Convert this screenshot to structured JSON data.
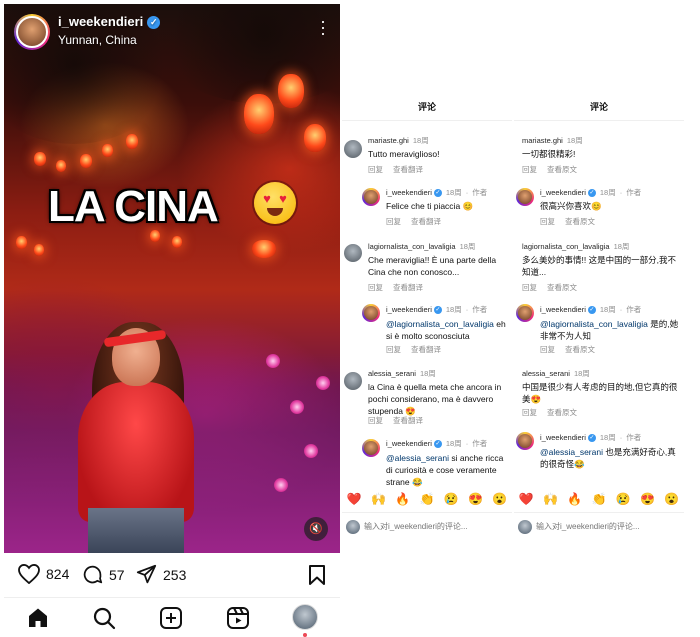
{
  "post": {
    "username": "i_weekendieri",
    "verified": true,
    "location": "Yunnan, China",
    "overlay_text": "LA CINA",
    "overlay_emoji": "heart-eyes-emoji",
    "likes": "824",
    "comments": "57",
    "shares": "253"
  },
  "icons": {
    "heart": "heart-icon",
    "comment": "comment-icon",
    "share": "share-icon",
    "bookmark": "bookmark-icon",
    "home": "home-icon",
    "search": "search-icon",
    "create": "create-icon",
    "reels": "reels-icon",
    "more": "more-icon",
    "mute": "mute-icon"
  },
  "colors": {
    "verified": "#3897f0",
    "mention": "#00376b",
    "meta": "#8e8e8e",
    "notification_dot": "#ed4956"
  },
  "pane_it": {
    "title": "评论",
    "comments": [
      {
        "user": "mariaste.ghi",
        "time": "18周",
        "author": "",
        "text": "Tutto meraviglioso!",
        "reply": "回复",
        "translate": "查看翻译"
      },
      {
        "user": "i_weekendieri",
        "time": "18周",
        "author": "作者",
        "text": "Felice che ti piaccia 😊",
        "reply": "回复",
        "translate": "查看翻译"
      },
      {
        "user": "lagiornalista_con_lavaligia",
        "time": "18周",
        "author": "",
        "text": "Che meraviglia!! È una parte della Cina che non conosco...",
        "reply": "回复",
        "translate": "查看翻译"
      },
      {
        "user": "i_weekendieri",
        "time": "18周",
        "author": "作者",
        "mention": "@lagiornalista_con_lavaligia",
        "text": " eh si è molto sconosciuta",
        "reply": "回复",
        "translate": "查看翻译"
      },
      {
        "user": "alessia_serani",
        "time": "18周",
        "author": "",
        "text": "la Cina è quella meta che ancora in pochi considerano, ma è davvero stupenda 😍",
        "reply": "回复",
        "translate": "查看翻译"
      },
      {
        "user": "i_weekendieri",
        "time": "18周",
        "author": "作者",
        "mention": "@alessia_serani",
        "text": " si anche ricca di curiosità e cose veramente strane 😂",
        "reply": "",
        "translate": ""
      }
    ],
    "input_placeholder": "输入对i_weekendieri的评论..."
  },
  "pane_zh": {
    "title": "评论",
    "comments": [
      {
        "user": "mariaste.ghi",
        "time": "18周",
        "author": "",
        "text": "一切都很精彩!",
        "reply": "回复",
        "translate": "查看原文"
      },
      {
        "user": "i_weekendieri",
        "time": "18周",
        "author": "作者",
        "text": "很高兴你喜欢😊",
        "reply": "回复",
        "translate": "查看原文"
      },
      {
        "user": "lagiornalista_con_lavaligia",
        "time": "18周",
        "author": "",
        "text": "多么美妙的事情!! 这是中国的一部分,我不知道...",
        "reply": "回复",
        "translate": "查看原文"
      },
      {
        "user": "i_weekendieri",
        "time": "18周",
        "author": "作者",
        "mention": "@lagiornalista_con_lavaligia",
        "text": " 是的,她非常不为人知",
        "reply": "回复",
        "translate": "查看原文"
      },
      {
        "user": "alessia_serani",
        "time": "18周",
        "author": "",
        "text": "中国是很少有人考虑的目的地,但它真的很美😍",
        "reply": "回复",
        "translate": "查看原文"
      },
      {
        "user": "i_weekendieri",
        "time": "18周",
        "author": "作者",
        "mention": "@alessia_serani",
        "text": " 也是充满好奇心,真的很奇怪😂",
        "reply": "",
        "translate": ""
      }
    ],
    "input_placeholder": "输入对i_weekendieri的评论..."
  },
  "reactions": [
    "❤️",
    "🙌",
    "🔥",
    "👏",
    "😢",
    "😍",
    "😮"
  ]
}
